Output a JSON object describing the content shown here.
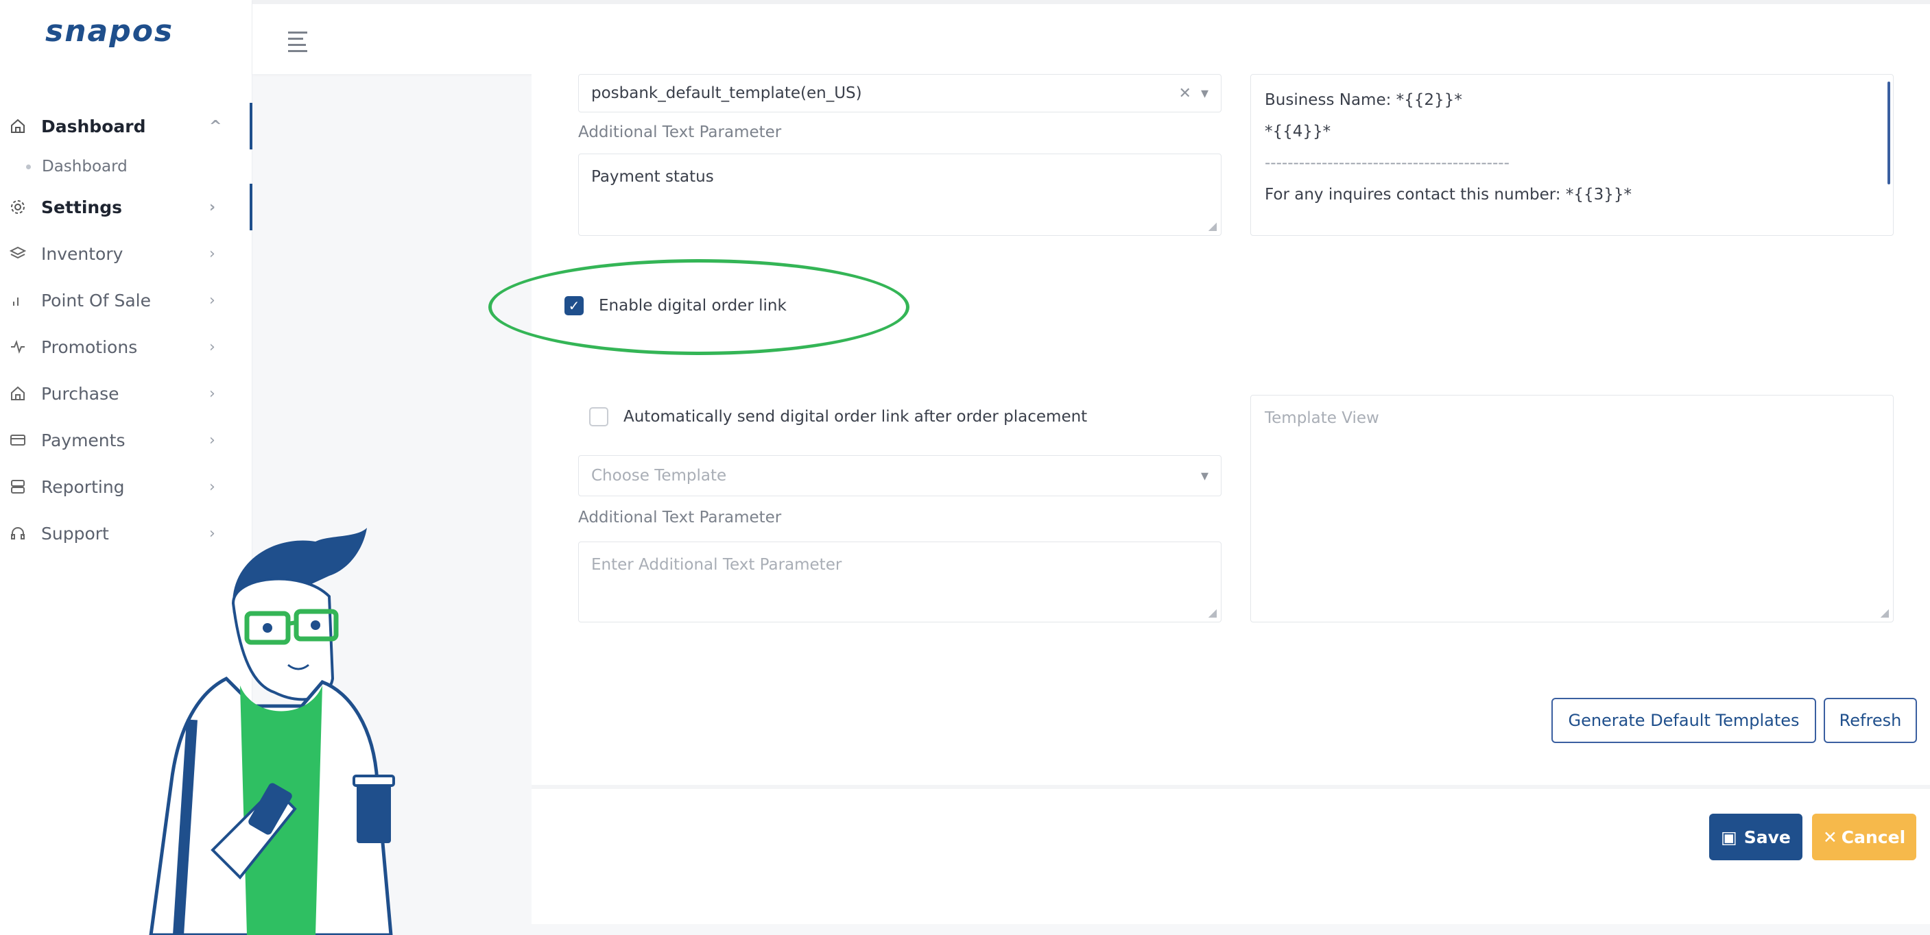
{
  "app": {
    "logo": "snapos"
  },
  "sidebar": {
    "items": [
      {
        "label": "Dashboard",
        "icon": "home-icon",
        "chevron": "^"
      },
      {
        "label": "Settings",
        "icon": "gear-icon",
        "chevron": "›"
      },
      {
        "label": "Inventory",
        "icon": "layers-icon",
        "chevron": "›"
      },
      {
        "label": "Point Of Sale",
        "icon": "bar-chart-icon",
        "chevron": "›"
      },
      {
        "label": "Promotions",
        "icon": "activity-icon",
        "chevron": "›"
      },
      {
        "label": "Purchase",
        "icon": "home-icon",
        "chevron": "›"
      },
      {
        "label": "Payments",
        "icon": "card-icon",
        "chevron": "›"
      },
      {
        "label": "Reporting",
        "icon": "server-icon",
        "chevron": "›"
      },
      {
        "label": "Support",
        "icon": "headphones-icon",
        "chevron": "›"
      }
    ],
    "sub_dashboard": "Dashboard"
  },
  "form": {
    "template_select_value": "posbank_default_template(en_US)",
    "additional_label_1": "Additional Text Parameter",
    "additional_value_1": "Payment status",
    "template_view_lines": [
      "Business Name: *{{2}}*",
      "*{{4}}*",
      "-------------------------------------------",
      "For any inquires contact this number: *{{3}}*"
    ],
    "enable_digital_order_link": {
      "label": "Enable digital order link",
      "checked": true
    },
    "auto_send": {
      "label": "Automatically send digital order link after order placement",
      "checked": false
    },
    "choose_template_placeholder": "Choose Template",
    "additional_label_2": "Additional Text Parameter",
    "additional_placeholder_2": "Enter Additional Text Parameter",
    "template_view_placeholder": "Template View"
  },
  "buttons": {
    "generate_default": "Generate Default Templates",
    "refresh": "Refresh",
    "save": "Save",
    "cancel": "Cancel"
  },
  "colors": {
    "primary": "#1f4f8c",
    "highlight": "#34b556",
    "cancel": "#f6b94b"
  }
}
